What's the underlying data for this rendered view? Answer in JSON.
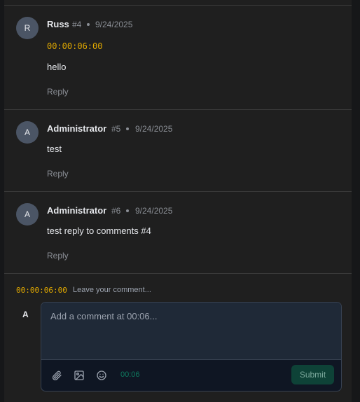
{
  "comments": [
    {
      "avatar": "R",
      "author": "Russ",
      "number": "#4",
      "date": "9/24/2025",
      "timestamp": "00:00:06:00",
      "text": "hello",
      "reply_label": "Reply"
    },
    {
      "avatar": "A",
      "author": "Administrator",
      "number": "#5",
      "date": "9/24/2025",
      "timestamp": "",
      "text": "test",
      "reply_label": "Reply"
    },
    {
      "avatar": "A",
      "author": "Administrator",
      "number": "#6",
      "date": "9/24/2025",
      "timestamp": "",
      "text": "test reply to comments #4",
      "reply_label": "Reply"
    }
  ],
  "composer": {
    "timestamp": "00:00:06:00",
    "hint": "Leave your comment...",
    "avatar": "A",
    "placeholder": "Add a comment at 00:06...",
    "time_chip": "00:06",
    "submit_label": "Submit",
    "tools": [
      "paperclip-icon",
      "image-icon",
      "emoji-icon"
    ]
  },
  "colors": {
    "accent_timestamp": "#e0a800",
    "submit_bg": "#0e4237"
  }
}
